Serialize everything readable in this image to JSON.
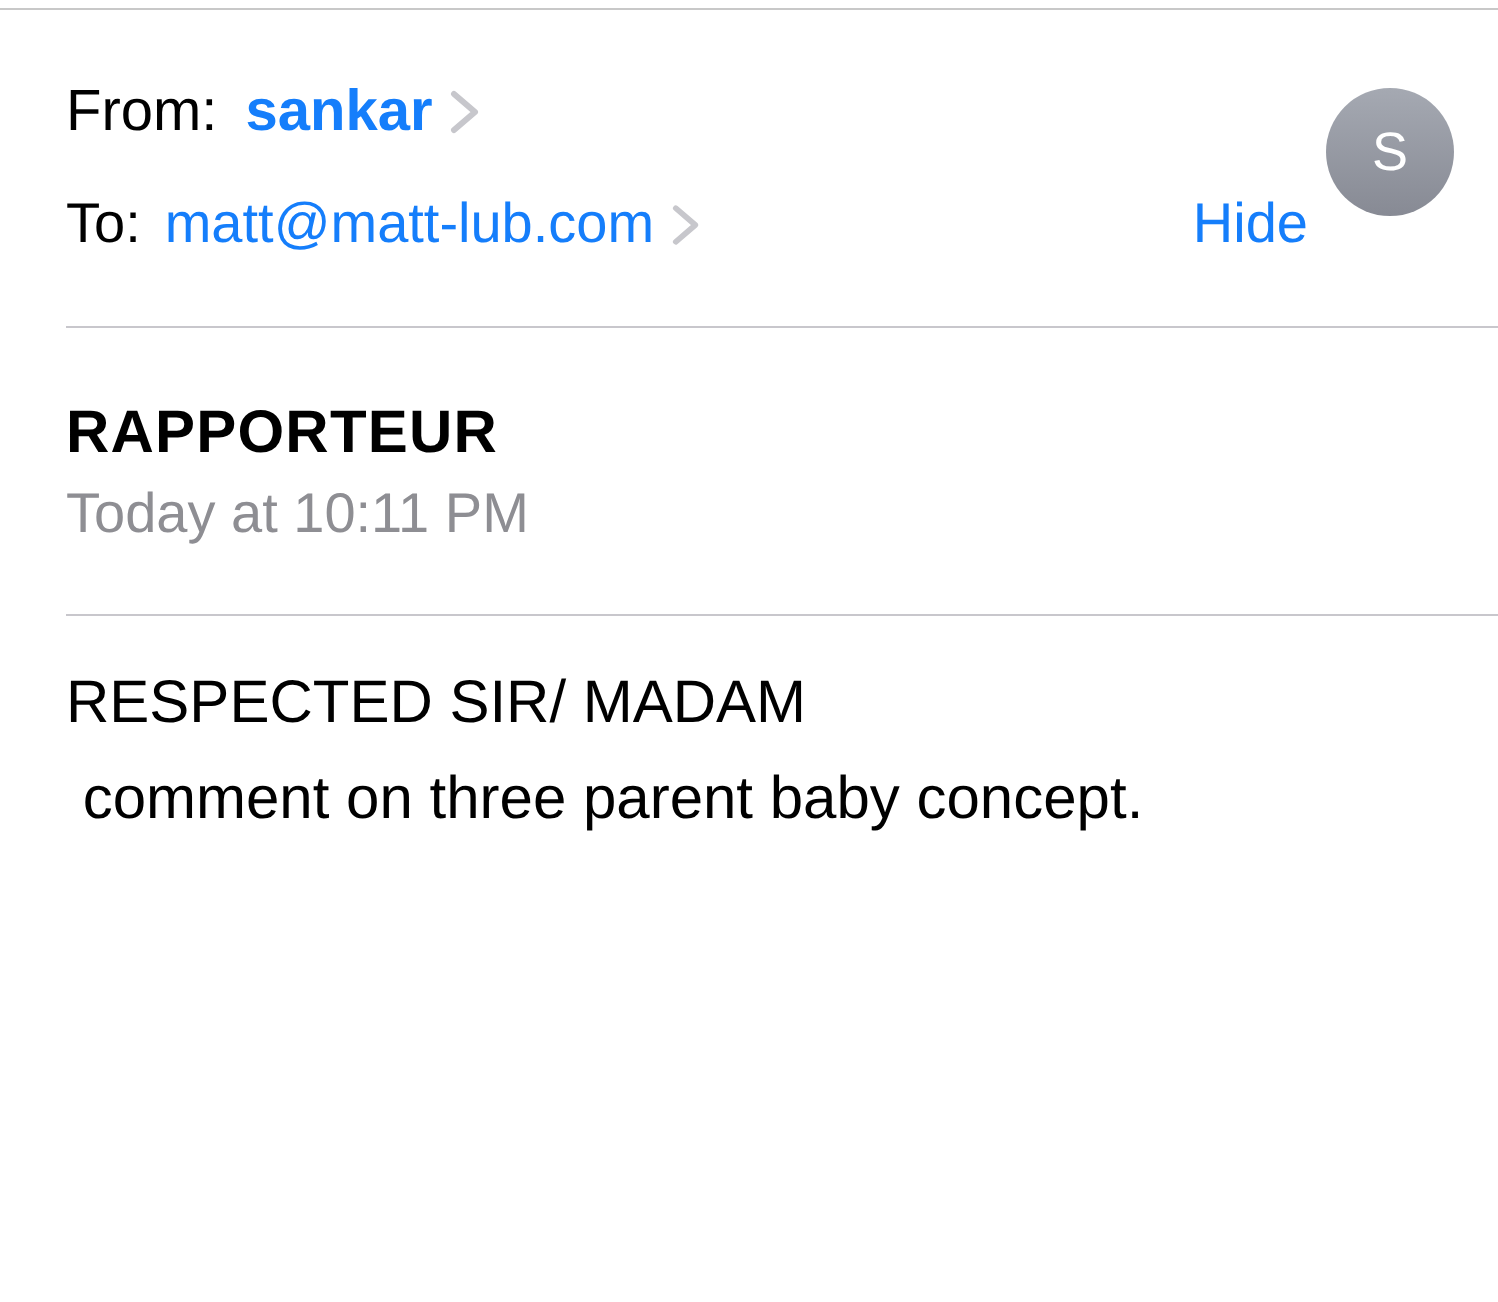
{
  "header": {
    "from_label": "From:",
    "sender": "sankar",
    "to_label": "To:",
    "recipient": "matt@matt-lub.com",
    "hide_link": "Hide",
    "avatar_initial": "S"
  },
  "message": {
    "subject": "RAPPORTEUR",
    "date": "Today at 10:11 PM",
    "body_lines": [
      "RESPECTED SIR/ MADAM",
      " comment on three parent baby concept."
    ]
  }
}
